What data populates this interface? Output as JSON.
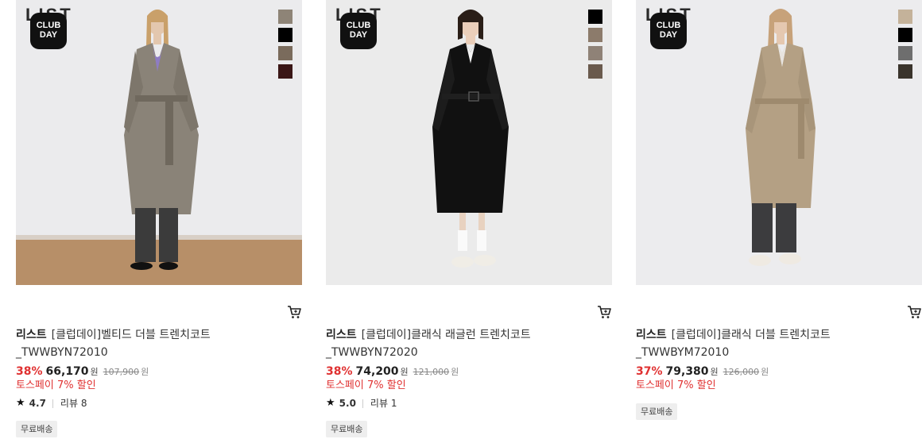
{
  "products": [
    {
      "logo": "LIST",
      "badge": [
        "CLUB",
        "DAY"
      ],
      "swatches": [
        "#8e8477",
        "#000000",
        "#7a6b5c",
        "#3a1616"
      ],
      "brand": "리스트",
      "title": "[클럽데이]벨티드 더블 트렌치코트 _TWWBYN72010",
      "discount": "38%",
      "price": "66,170",
      "price_unit": "원",
      "original_price": "107,900",
      "original_unit": "원",
      "promo": "토스페이 7% 할인",
      "rating": "4.7",
      "reviews": "리뷰 8",
      "shipping": "무료배송"
    },
    {
      "logo": "LIST",
      "badge": [
        "CLUB",
        "DAY"
      ],
      "swatches": [
        "#000000",
        "#8c7b6b",
        "#8f8277",
        "#6a5a4d"
      ],
      "brand": "리스트",
      "title": "[클럽데이]클래식 래글런 트렌치코트 _TWWBYN72020",
      "discount": "38%",
      "price": "74,200",
      "price_unit": "원",
      "original_price": "121,000",
      "original_unit": "원",
      "promo": "토스페이 7% 할인",
      "rating": "5.0",
      "reviews": "리뷰 1",
      "shipping": "무료배송"
    },
    {
      "logo": "LIST",
      "badge": [
        "CLUB",
        "DAY"
      ],
      "swatches": [
        "#c4b29a",
        "#000000",
        "#6e6e6e",
        "#3a342c"
      ],
      "brand": "리스트",
      "title": "[클럽데이]클래식 더블 트렌치코트 _TWWBYM72010",
      "discount": "37%",
      "price": "79,380",
      "price_unit": "원",
      "original_price": "126,000",
      "original_unit": "원",
      "promo": "토스페이 7% 할인",
      "rating": null,
      "reviews": null,
      "shipping": "무료배송"
    }
  ],
  "icons": {
    "cart": "cart-icon",
    "star": "star-icon"
  },
  "colors": {
    "discount": "#e03131",
    "promo": "#e03131"
  }
}
